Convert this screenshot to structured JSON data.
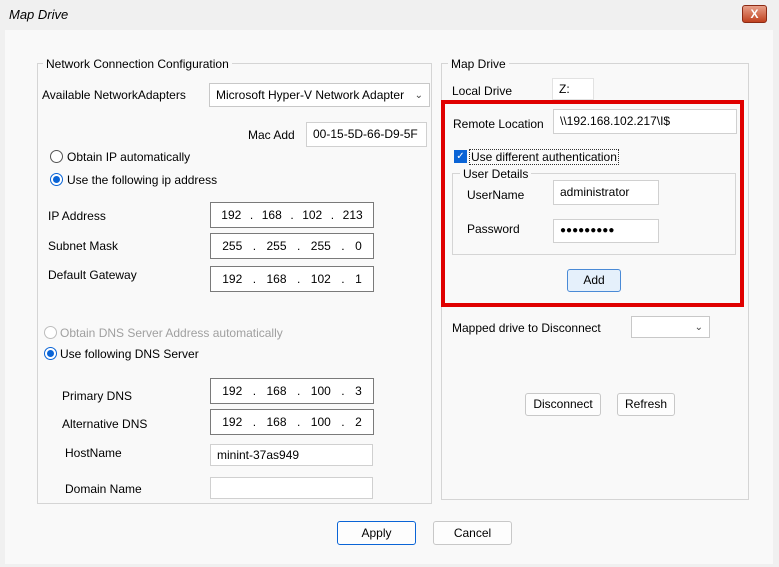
{
  "window": {
    "title": "Map Drive",
    "close_label": "X"
  },
  "network": {
    "legend": "Network Connection Configuration",
    "adapters_label": "Available NetworkAdapters",
    "adapter_value": "Microsoft Hyper-V Network Adapter",
    "mac_label": "Mac Add",
    "mac_value": "00-15-5D-66-D9-5F",
    "obtain_ip_label": "Obtain IP automatically",
    "use_ip_label": "Use the following ip address",
    "ip_label": "IP Address",
    "ip": [
      "192",
      "168",
      "102",
      "213"
    ],
    "subnet_label": "Subnet Mask",
    "subnet": [
      "255",
      "255",
      "255",
      "0"
    ],
    "gateway_label": "Default Gateway",
    "gateway": [
      "192",
      "168",
      "102",
      "1"
    ],
    "obtain_dns_label": "Obtain DNS Server Address automatically",
    "use_dns_label": "Use following DNS Server",
    "primary_dns_label": "Primary DNS",
    "primary_dns": [
      "192",
      "168",
      "100",
      "3"
    ],
    "alt_dns_label": "Alternative DNS",
    "alt_dns": [
      "192",
      "168",
      "100",
      "2"
    ],
    "hostname_label": "HostName",
    "hostname_value": "minint-37as949",
    "domain_label": "Domain Name",
    "domain_value": ""
  },
  "mapdrive": {
    "legend": "Map Drive",
    "local_drive_label": "Local Drive",
    "local_drive_value": "Z:",
    "remote_label": "Remote Location",
    "remote_value": "\\\\192.168.102.217\\I$",
    "diff_auth_label": "Use different authentication",
    "user_details_legend": "User Details",
    "username_label": "UserName",
    "username_value": "administrator",
    "password_label": "Password",
    "password_value": "●●●●●●●●●",
    "add_label": "Add",
    "mapped_disconnect_label": "Mapped drive to Disconnect",
    "mapped_disconnect_value": "",
    "disconnect_label": "Disconnect",
    "refresh_label": "Refresh"
  },
  "footer": {
    "apply_label": "Apply",
    "cancel_label": "Cancel"
  },
  "colors": {
    "highlight": "#e00000",
    "accent": "#0a64d6"
  }
}
